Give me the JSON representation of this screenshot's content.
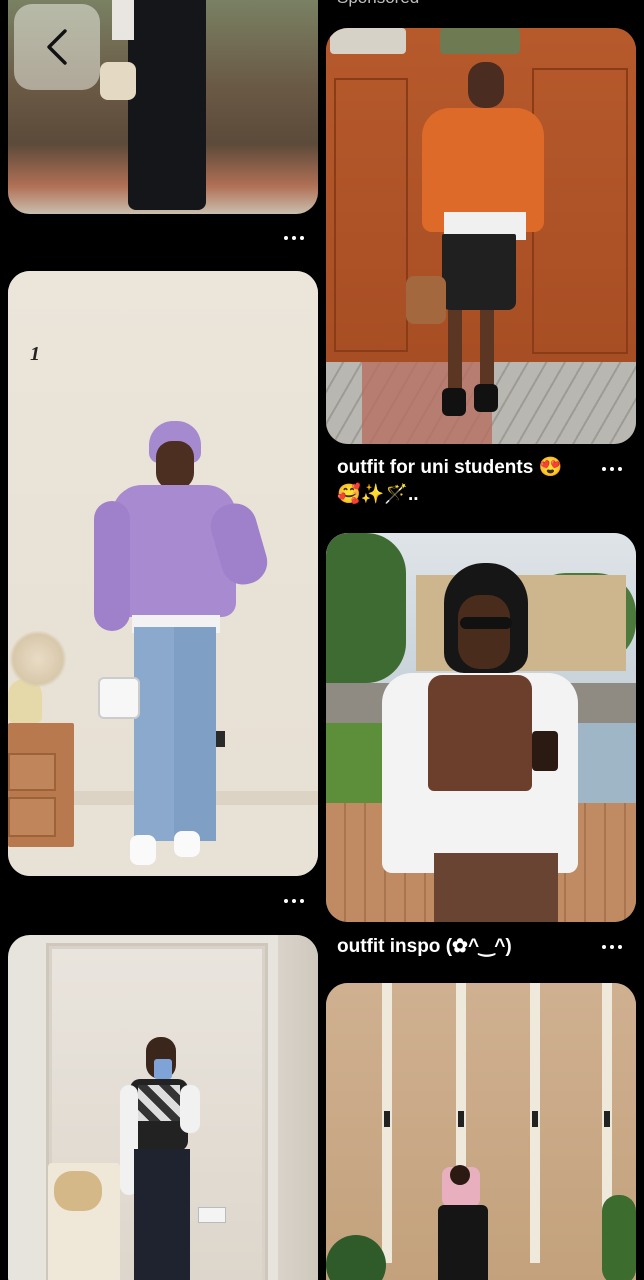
{
  "header": {
    "sponsored_label": "Sponsored"
  },
  "pins": [
    {
      "id": "pin-left-top",
      "alt_icon": "more-icon"
    },
    {
      "id": "pin-sponsored-orange",
      "caption_line1": "outfit for uni students 😍",
      "caption_line2": "🥰✨🪄.."
    },
    {
      "id": "pin-left-purple",
      "overlay_text": "1"
    },
    {
      "id": "pin-right-brown",
      "caption_line1": "outfit inspo (✿^‿^)"
    },
    {
      "id": "pin-left-mirror"
    },
    {
      "id": "pin-right-building"
    }
  ],
  "colors": {
    "background": "#000000",
    "text": "#ffffff"
  }
}
